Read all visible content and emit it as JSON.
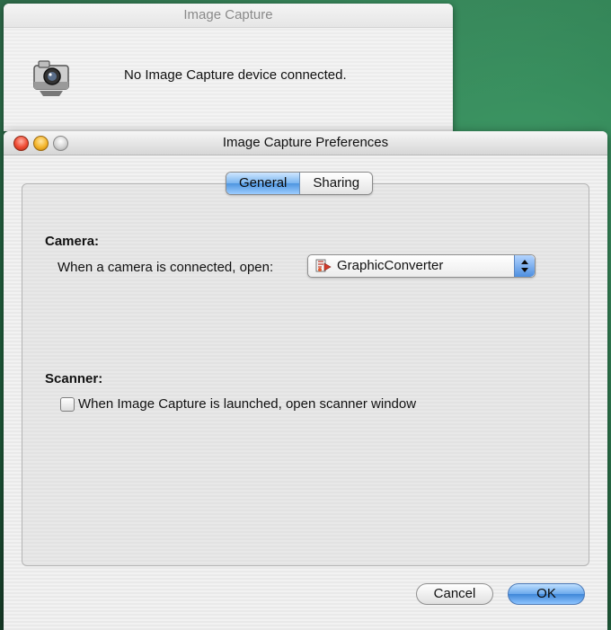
{
  "back_window": {
    "title": "Image Capture",
    "message": "No Image Capture device connected.",
    "icon": "camera-icon"
  },
  "prefs_window": {
    "title": "Image Capture Preferences",
    "tabs": [
      {
        "label": "General",
        "selected": true
      },
      {
        "label": "Sharing",
        "selected": false
      }
    ],
    "camera": {
      "section_label": "Camera:",
      "open_label": "When a camera is connected, open:",
      "selected_app": "GraphicConverter",
      "app_icon": "graphicconverter-app-icon"
    },
    "scanner": {
      "section_label": "Scanner:",
      "checkbox_label": "When Image Capture is launched, open scanner window",
      "checked": false
    },
    "buttons": {
      "cancel": "Cancel",
      "ok": "OK"
    }
  },
  "colors": {
    "accent": "#4f96e0",
    "desktop": "#2f7f52",
    "close": "#ef4a32",
    "minimize": "#f4b52b"
  }
}
